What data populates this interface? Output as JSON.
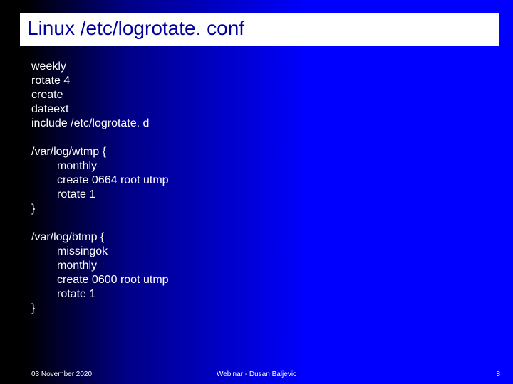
{
  "title": "Linux /etc/logrotate. conf",
  "globals": [
    "weekly",
    "rotate 4",
    "create",
    "dateext",
    "include /etc/logrotate. d"
  ],
  "sections": [
    {
      "open": "/var/log/wtmp {",
      "body": [
        "monthly",
        "create 0664 root utmp",
        "rotate 1"
      ],
      "close": "}"
    },
    {
      "open": "/var/log/btmp {",
      "body": [
        "missingok",
        "monthly",
        "create 0600 root utmp",
        "rotate 1"
      ],
      "close": "}"
    }
  ],
  "footer": {
    "date": "03 November 2020",
    "center": "Webinar - Dusan Baljevic",
    "page": "8"
  }
}
